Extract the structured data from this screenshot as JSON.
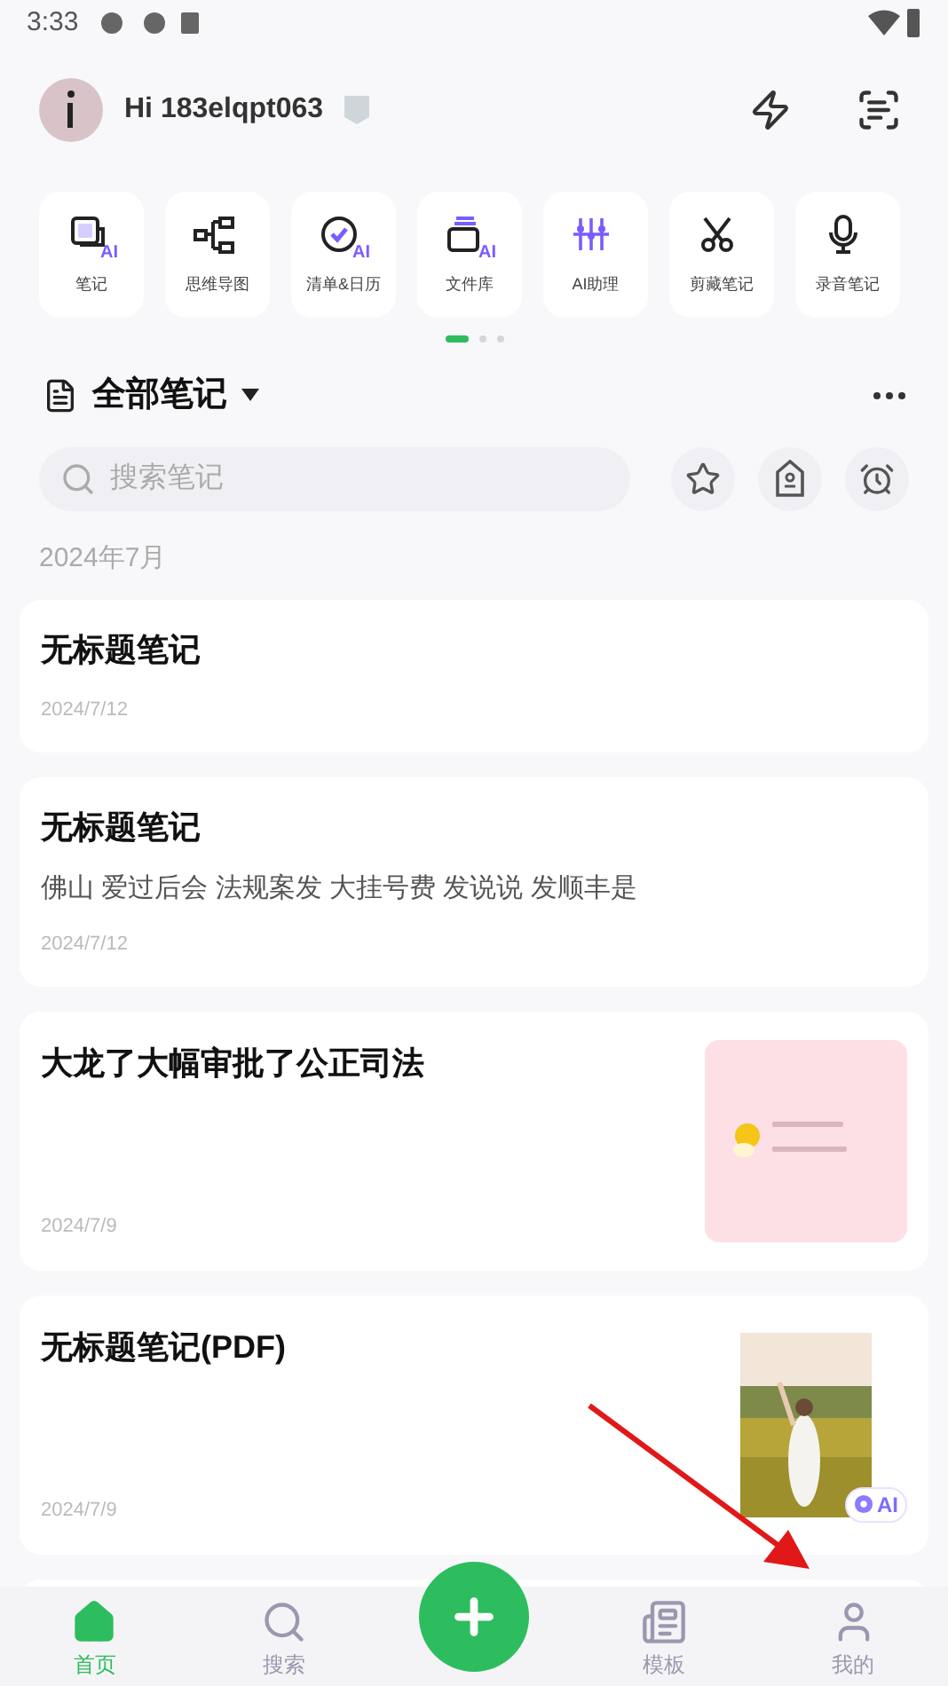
{
  "status_bar": {
    "time": "3:33"
  },
  "header": {
    "greeting": "Hi 183elqpt063"
  },
  "tools": [
    {
      "label": "笔记",
      "kind": "note",
      "badge": "AI"
    },
    {
      "label": "思维导图",
      "kind": "mindmap"
    },
    {
      "label": "清单&日历",
      "kind": "todo",
      "badge": "AI"
    },
    {
      "label": "文件库",
      "kind": "files",
      "badge": "AI"
    },
    {
      "label": "AI助理",
      "kind": "assistant"
    },
    {
      "label": "剪藏笔记",
      "kind": "clip"
    },
    {
      "label": "录音笔记",
      "kind": "record"
    }
  ],
  "pager": [
    {
      "selected": true
    },
    {
      "selected": false
    },
    {
      "selected": false
    }
  ],
  "notes_header": {
    "title": "全部笔记"
  },
  "search": {
    "placeholder": "搜索笔记"
  },
  "month": "2024年7月",
  "notes": [
    {
      "title": "无标题笔记",
      "date": "2024/7/12"
    },
    {
      "title": "无标题笔记",
      "snippet": "佛山 爱过后会 法规案发 大挂号费 发说说 发顺丰是",
      "date": "2024/7/12"
    },
    {
      "title": "大龙了大幅审批了公正司法",
      "date": "2024/7/9"
    },
    {
      "title": "无标题笔记(PDF)",
      "date": "2024/7/9",
      "badge": "AI"
    }
  ],
  "nav": [
    {
      "label": "首页",
      "kind": "home",
      "selected": true
    },
    {
      "label": "搜索",
      "kind": "search",
      "selected": false
    },
    {
      "kind": "add"
    },
    {
      "label": "模板",
      "kind": "template",
      "selected": false
    },
    {
      "label": "我的",
      "kind": "me",
      "selected": false
    }
  ]
}
